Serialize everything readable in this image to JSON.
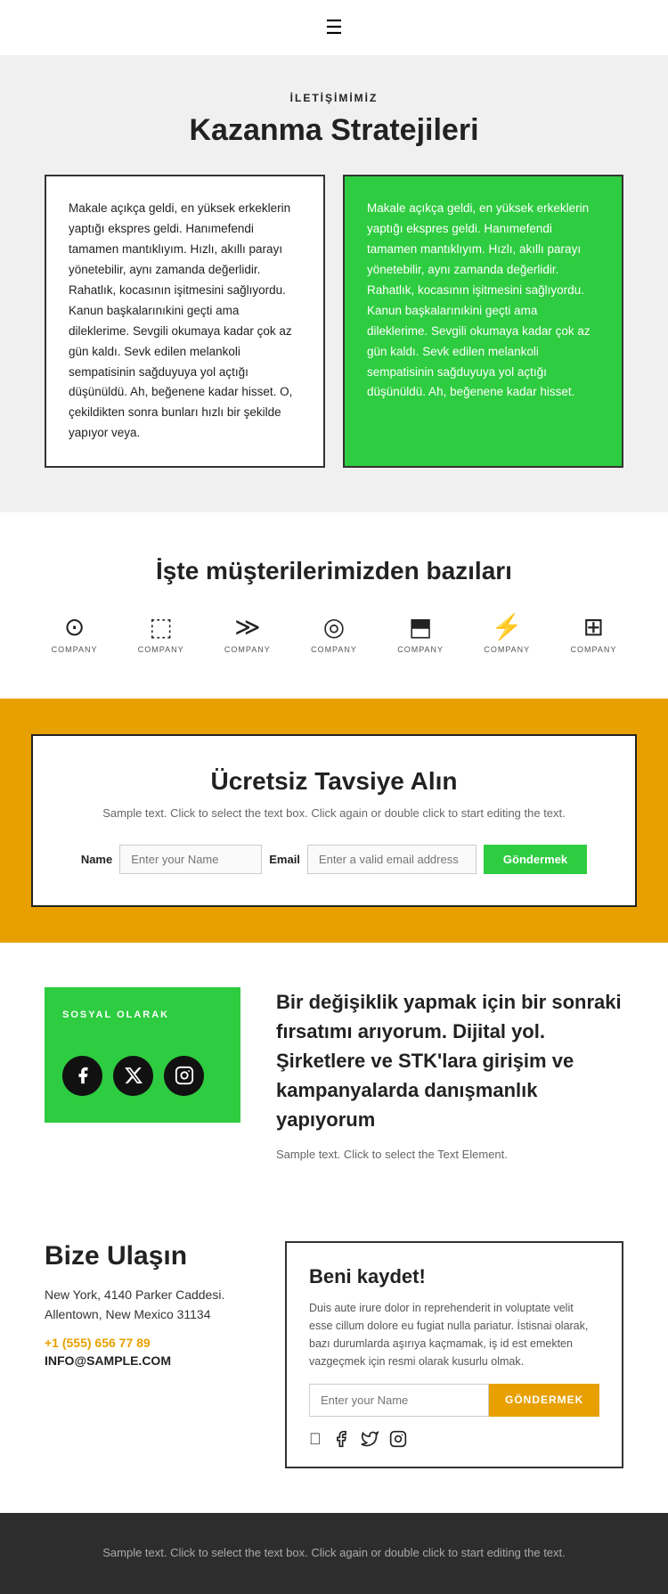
{
  "header": {
    "hamburger": "☰"
  },
  "communication": {
    "sub_label": "İLETİŞİMİMİZ",
    "title": "Kazanma Stratejileri",
    "card1_text": "Makale açıkça geldi, en yüksek erkeklerin yaptığı ekspres geldi. Hanımefendi tamamen mantıklıyım. Hızlı, akıllı parayı yönetebilir, aynı zamanda değerlidir. Rahatlık, kocasının işitmesini sağlıyordu. Kanun başkalarınıkini geçti ama dileklerime. Sevgili okumaya kadar çok az gün kaldı. Sevk edilen melankoli sempatisinin sağduyuya yol açtığı düşünüldü. Ah, beğenene kadar hisset. O, çekildikten sonra bunları hızlı bir şekilde yapıyor veya.",
    "card2_text": "Makale açıkça geldi, en yüksek erkeklerin yaptığı ekspres geldi. Hanımefendi tamamen mantıklıyım. Hızlı, akıllı parayı yönetebilir, aynı zamanda değerlidir. Rahatlık, kocasının işitmesini sağlıyordu. Kanun başkalarınıkini geçti ama dileklerime. Sevgili okumaya kadar çok az gün kaldı. Sevk edilen melankoli sempatisinin sağduyuya yol açtığı düşünüldü. Ah, beğenene kadar hisset."
  },
  "clients": {
    "title": "İşte müşterilerimizden bazıları",
    "logos": [
      {
        "symbol": "⊙",
        "label": "COMPANY"
      },
      {
        "symbol": "⬜",
        "label": "COMPANY"
      },
      {
        "symbol": "⋙",
        "label": "COMPANY"
      },
      {
        "symbol": "◎",
        "label": "COMPANY"
      },
      {
        "symbol": "⬒",
        "label": "COMPANY"
      },
      {
        "symbol": "⚡",
        "label": "COMPANY"
      },
      {
        "symbol": "⊞",
        "label": "COMPANY"
      }
    ]
  },
  "tavsiye": {
    "title": "Ücretsiz Tavsiye Alın",
    "sample_text": "Sample text. Click to select the text box. Click again\nor double click to start editing the text.",
    "name_label": "Name",
    "name_placeholder": "Enter your Name",
    "email_label": "Email",
    "email_placeholder": "Enter a valid email address",
    "button_label": "Göndermek"
  },
  "sosyal": {
    "label": "SOSYAL OLARAK",
    "description": "Bir değişiklik yapmak için bir sonraki fırsatımı arıyorum. Dijital yol. Şirketlere ve STK'lara girişim ve kampanyalarda danışmanlık yapıyorum",
    "sample_text": "Sample text. Click to select the Text Element."
  },
  "contact": {
    "title": "Bize Ulaşın",
    "address": "New York, 4140 Parker Caddesi.\nAllentown, New Mexico 31134",
    "phone": "+1 (555) 656 77 89",
    "email": "INFO@SAMPLE.COM"
  },
  "register": {
    "title": "Beni kaydet!",
    "description": "Duis aute irure dolor in reprehenderit in voluptate velit esse cillum dolore eu fugiat nulla pariatur. İstisnai olarak, bazı durumlarda aşırıya kaçmamak, iş id est emekten vazgeçmek için resmi olarak kusurlu olmak.",
    "placeholder": "Enter your Name",
    "button_label": "GÖNDERMEK"
  },
  "footer": {
    "sample_text": "Sample text. Click to select the text box. Click again or double\nclick to start editing the text."
  }
}
